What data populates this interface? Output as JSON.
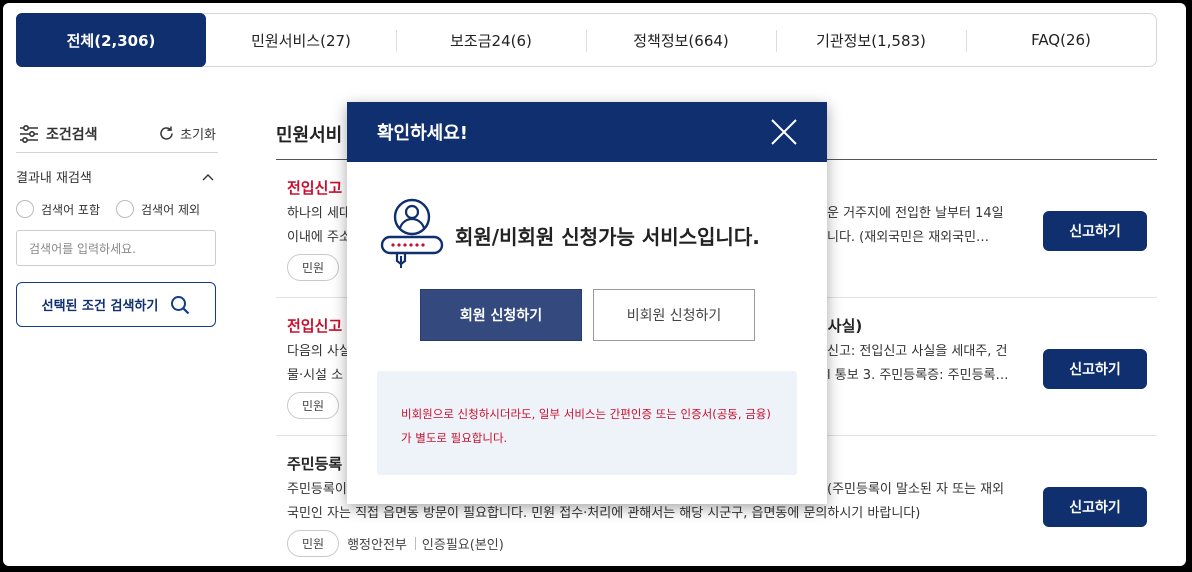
{
  "tabs": [
    {
      "label": "전체(2,306)",
      "active": true
    },
    {
      "label": "민원서비스(27)",
      "active": false
    },
    {
      "label": "보조금24(6)",
      "active": false
    },
    {
      "label": "정책정보(664)",
      "active": false
    },
    {
      "label": "기관정보(1,583)",
      "active": false
    },
    {
      "label": "FAQ(26)",
      "active": false
    }
  ],
  "sidebar": {
    "title": "조건검색",
    "reset_label": "초기화",
    "refine_label": "결과내 재검색",
    "include_label": "검색어 포함",
    "exclude_label": "검색어 제외",
    "keyword_placeholder": "검색어를 입력하세요.",
    "search_button": "선택된 조건 검색하기"
  },
  "main": {
    "section_title": "민원서비",
    "items": [
      {
        "title": "전입신고",
        "title_red": true,
        "desc_left_1": "하나의 세대",
        "desc_left_2": "이내에 주소",
        "desc_right_1": "운 거주지에 전입한 날부터 14일",
        "desc_right_2": "니다. (재외국민은 재외국민…",
        "tags": [
          "민원"
        ],
        "button": "신고하기"
      },
      {
        "title": "전입신고",
        "title_tail": "경사실)",
        "title_red": true,
        "desc_left_1": "다음의 사실",
        "desc_left_2": "물·시설 소",
        "desc_right_1": "신고: 전입신고 사실을 세대주, 건",
        "desc_right_2": "l 통보 3. 주민등록증: 주민등록…",
        "tags": [
          "민원"
        ],
        "button": "신고하기"
      },
      {
        "title": "주민등록",
        "title_red": false,
        "desc_left_1": "주민등록이",
        "desc_full_2": "국민인 자는 직접 읍면동 방문이 필요합니다. 민원 접수·처리에 관해서는 해당 시군구, 읍면동에 문의하시기 바랍니다)",
        "desc_right_1": "(주민등록이 말소된 자 또는 재외",
        "tags": [
          "민원",
          "행정안전부",
          "인증필요(본인)"
        ],
        "button": "신고하기"
      }
    ]
  },
  "modal": {
    "title": "확인하세요!",
    "message": "회원/비회원 신청가능 서비스입니다.",
    "member_button": "회원 신청하기",
    "nonmember_button": "비회원 신청하기",
    "notice_1": "비회원으로 신청하시더라도, 일부 서비스는 간편인증 또는 인증서(공동, 금융)",
    "notice_2": "가 별도로 필요합니다."
  },
  "colors": {
    "primary": "#0f2f6e",
    "modal_primary_button": "#34497e",
    "accent_red": "#c8102e",
    "notice_bg": "#eef3f9"
  }
}
